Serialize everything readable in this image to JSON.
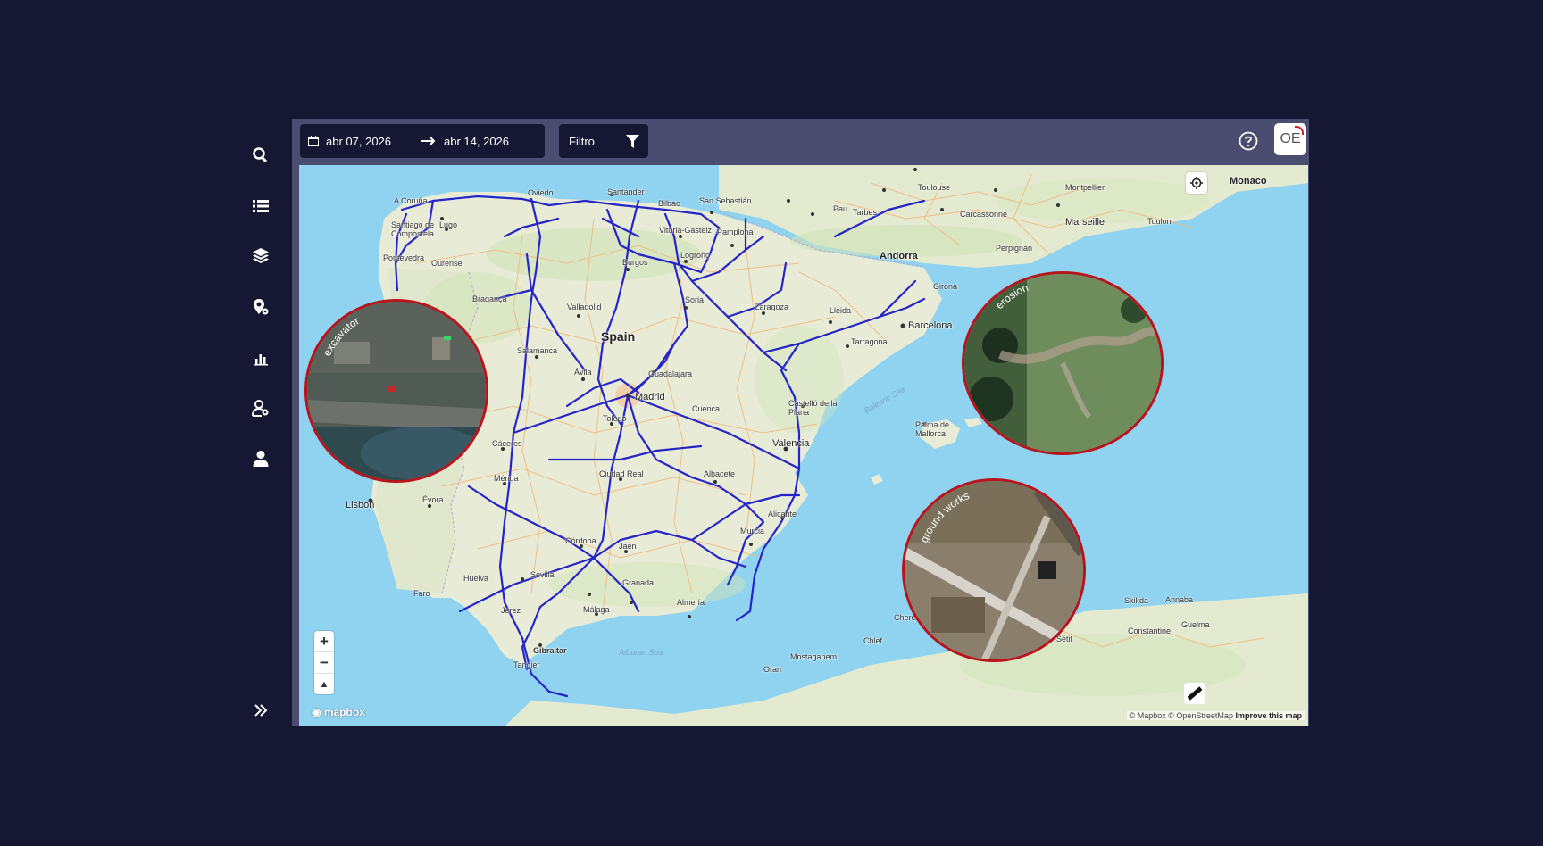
{
  "sidebar": {
    "items": [
      {
        "icon": "search-icon"
      },
      {
        "icon": "list-icon"
      },
      {
        "icon": "layers-icon"
      },
      {
        "icon": "map-pin-settings-icon"
      },
      {
        "icon": "bar-chart-icon"
      },
      {
        "icon": "user-settings-icon"
      },
      {
        "icon": "user-icon"
      }
    ],
    "expand_icon": "double-chevron-right-icon"
  },
  "toolbar": {
    "date_from": "abr 07, 2026",
    "date_to": "abr 14, 2026",
    "filter_label": "Filtro",
    "avatar_initials": "OE"
  },
  "map": {
    "labels": {
      "spain": "Spain",
      "madrid": "Madrid",
      "andorra": "Andorra",
      "barcelona": "Barcelona",
      "valencia": "Valencia",
      "lisbon": "Lisbon",
      "monaco": "Monaco",
      "marseille": "Marseille",
      "toulouse": "Toulouse",
      "montpellier": "Montpellier",
      "carcassonne": "Carcassonne",
      "perpignan": "Perpignan",
      "toulon": "Toulon",
      "pau": "Pau",
      "tarbes": "Tarbes",
      "a_coruna": "A Coruña",
      "santiago": "Santiago de Compostela",
      "lugo": "Lugo",
      "oviedo": "Oviedo",
      "santander": "Santander",
      "bilbao": "Bilbao",
      "san_sebastian": "San Sebastián",
      "pontevedra": "Pontevedra",
      "ourense": "Ourense",
      "vitoria": "Vitoria-Gasteiz",
      "pamplona": "Pamplona",
      "logrono": "Logroño",
      "burgos": "Burgos",
      "braganca": "Bragança",
      "valladolid": "Valladolid",
      "soria": "Soria",
      "zaragoza": "Zaragoza",
      "lleida": "Lleida",
      "girona": "Girona",
      "tarragona": "Tarragona",
      "salamanca": "Salamanca",
      "avila": "Ávila",
      "guadalajara": "Guadalajara",
      "toledo": "Toledo",
      "cuenca": "Cuenca",
      "castellon": "Castelló de la Plana",
      "caceres": "Cáceres",
      "merida": "Mérida",
      "evora": "Évora",
      "ciudad_real": "Ciudad Real",
      "albacete": "Albacete",
      "alicante": "Alicante",
      "murcia": "Murcia",
      "cordoba": "Córdoba",
      "jaen": "Jaén",
      "sevilla": "Sevilla",
      "huelva": "Huelva",
      "faro": "Faro",
      "granada": "Granada",
      "malaga": "Málaga",
      "almeria": "Almería",
      "jerez": "Jerez",
      "gibraltar": "Gibraltar",
      "tangier": "Tangier",
      "palma": "Palma de Mallorca",
      "balearic_sea": "Balearic Sea",
      "alboran_sea": "Alboran Sea",
      "mostaganem": "Mostaganem",
      "oran": "Oran",
      "chlef": "Chlef",
      "cherchell": "Cherchell",
      "setif": "Sétif",
      "skikda": "Skikda",
      "annaba": "Annaba",
      "constantine": "Constantine",
      "guelma": "Guelma"
    },
    "attribution": "© Mapbox © OpenStreetMap",
    "improve_link": "Improve this map",
    "logo_text": "mapbox",
    "zoom_in": "+",
    "zoom_out": "−",
    "compass": "▲"
  },
  "insets": [
    {
      "label": "excavator"
    },
    {
      "label": "erosion"
    },
    {
      "label": "ground works"
    }
  ],
  "colors": {
    "background": "#151733",
    "frame": "#4a4c70",
    "route": "#2424c8",
    "inset_border": "#b8141c",
    "sea": "#8fd3f0",
    "land": "#e8ecd6"
  }
}
